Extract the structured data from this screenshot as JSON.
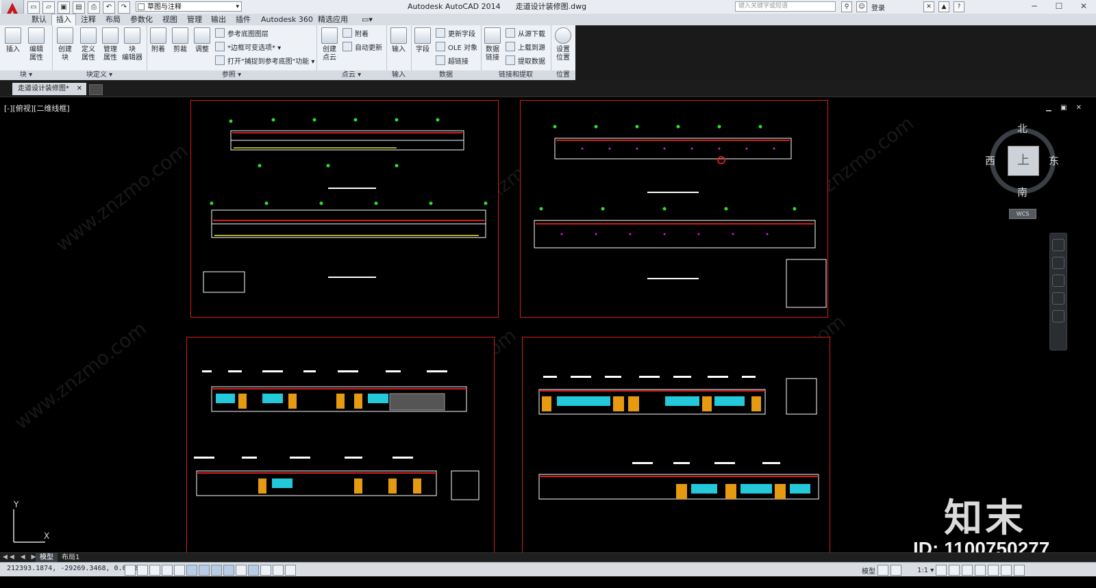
{
  "titlebar": {
    "workspace": "草图与注释",
    "app_name": "Autodesk AutoCAD 2014",
    "file_name": "走道设计装修图.dwg",
    "search_placeholder": "键入关键字或短语",
    "login": "登录",
    "help": "?"
  },
  "tabs": [
    "默认",
    "插入",
    "注释",
    "布局",
    "参数化",
    "视图",
    "管理",
    "输出",
    "插件",
    "Autodesk 360",
    "精选应用"
  ],
  "active_tab": "插入",
  "ribbon": {
    "panels": {
      "block": {
        "title": "块 ▾",
        "buttons": [
          "插入",
          "编辑\n属性"
        ]
      },
      "blockdef": {
        "title": "块定义 ▾",
        "buttons": [
          "创建\n块",
          "定义\n属性",
          "管理\n属性",
          "块\n编辑器"
        ]
      },
      "reference": {
        "title": "参照 ▾",
        "buttons": [
          "附着",
          "剪裁",
          "调整"
        ],
        "small": [
          "参考底图图层",
          "*边框可变选项* ▾",
          "打开\"捕捉到参考底图\"功能 ▾"
        ]
      },
      "pointcloud": {
        "title": "点云 ▾",
        "buttons": [
          "创建\n点云"
        ],
        "small": [
          "附着",
          "自动更新"
        ]
      },
      "import": {
        "title": "输入",
        "buttons": [
          "输入"
        ]
      },
      "data": {
        "title": "数据",
        "buttons": [
          "字段"
        ],
        "small": [
          "更新字段",
          "OLE 对象",
          "超链接"
        ]
      },
      "linking": {
        "title": "链接和提取",
        "buttons": [
          "数据\n链接"
        ],
        "small": [
          "从源下载",
          "上载到源",
          "提取数据"
        ]
      },
      "location": {
        "title": "位置",
        "buttons": [
          "设置\n位置"
        ]
      }
    }
  },
  "document_tab": "走道设计装修图*",
  "viewport_label": "[-][俯视][二维线框]",
  "viewport_controls": "▁ ▣ ✕",
  "viewcube": {
    "north": "北",
    "south": "南",
    "east": "东",
    "west": "西",
    "face": "上",
    "wcs": "WCS"
  },
  "ucs": {
    "x": "X",
    "y": "Y"
  },
  "watermark": "www.znzmo.com",
  "brand": {
    "logo_text": "知末",
    "id_text": "ID: 1100750277"
  },
  "layout_tabs": [
    "模型",
    "布局1"
  ],
  "layout_nav": "◀◀ ◀ ▶ ▶▶",
  "status": {
    "coordinates": "212393.1874, -29269.3468, 0.0000",
    "model_label": "模型",
    "scale": "1:1 ▾"
  },
  "colors": {
    "accent_red": "#d31d1d",
    "cad_background": "#000000",
    "ribbon_bg": "#eef1f5"
  }
}
